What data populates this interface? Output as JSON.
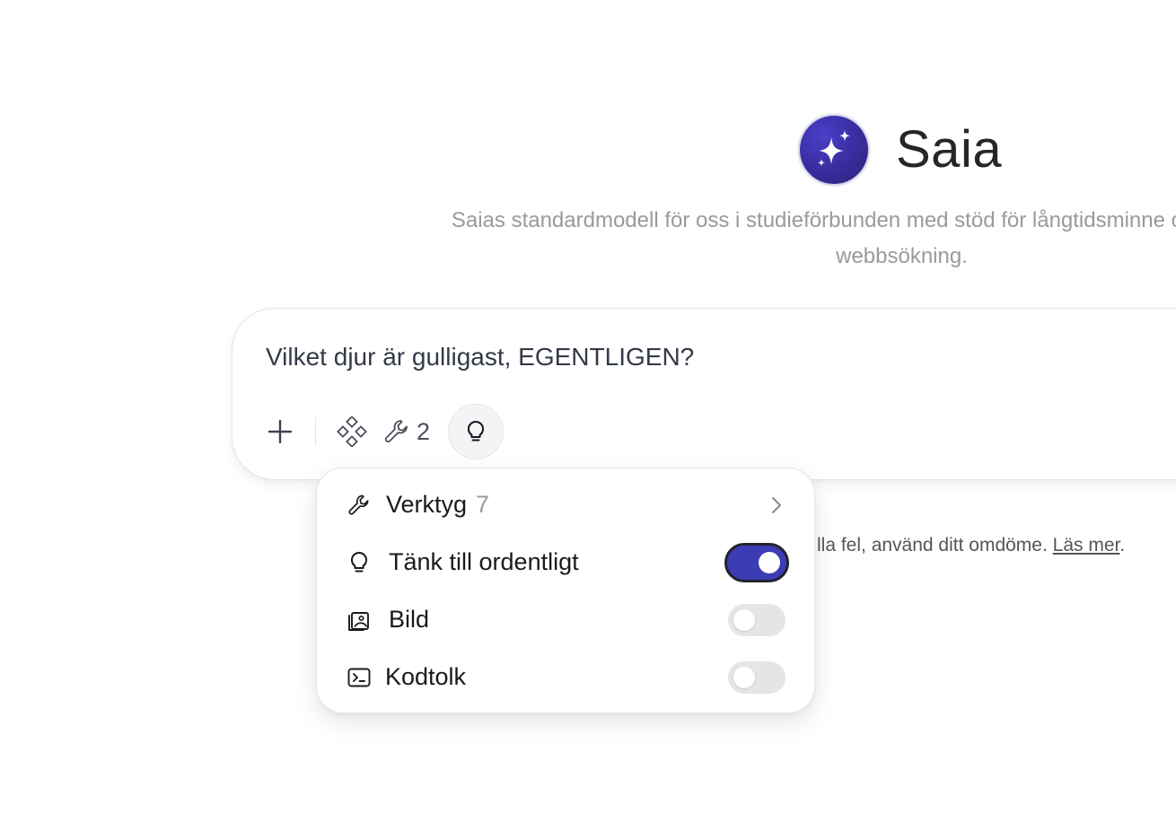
{
  "assistant": {
    "name": "Saia",
    "description": "Saias standardmodell för oss i studieförbunden med stöd för långtidsminne och användning av webbsökning.",
    "avatar_icon": "sparkles-icon"
  },
  "composer": {
    "prompt_text": "Vilket djur är gulligast, EGENTLIGEN?",
    "toolbar": {
      "add_icon": "plus-icon",
      "apps_icon": "apps-icon",
      "tools_icon": "wrench-icon",
      "tools_count": "2",
      "think_icon": "lightbulb-icon"
    }
  },
  "disclaimer": {
    "text": "lla fel, använd ditt omdöme. ",
    "link": "Läs mer",
    "end": "."
  },
  "menu": {
    "items": [
      {
        "label": "Verktyg",
        "count": "7",
        "icon": "wrench-icon",
        "type": "submenu"
      },
      {
        "label": "Tänk till ordentligt",
        "icon": "lightbulb-icon",
        "type": "toggle",
        "on": true
      },
      {
        "label": "Bild",
        "icon": "image-icon",
        "type": "toggle",
        "on": false
      },
      {
        "label": "Kodtolk",
        "icon": "terminal-icon",
        "type": "toggle",
        "on": false
      }
    ]
  },
  "colors": {
    "accent": "#3c3cb4",
    "avatar": "#3b2fa6"
  }
}
